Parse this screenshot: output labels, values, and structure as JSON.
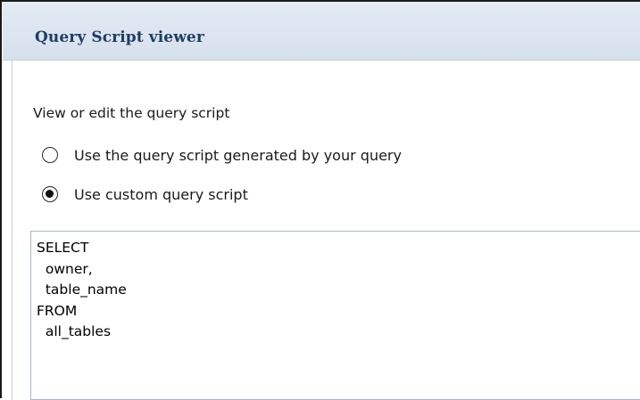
{
  "dialog": {
    "title": "Query Script viewer"
  },
  "main": {
    "instruction": "View or edit the query script",
    "options": [
      {
        "label": "Use the query script generated by your query",
        "selected": false
      },
      {
        "label": "Use custom query script",
        "selected": true
      }
    ],
    "script": {
      "lines": [
        "SELECT",
        "  owner,",
        "  table_name",
        "FROM",
        "  all_tables"
      ]
    }
  },
  "colors": {
    "title_text": "#1f3c66",
    "title_bar": "#dfe7f1",
    "editor_border": "#a9b7c6"
  },
  "icons": {
    "radio_unselected": "radio-unselected-icon",
    "radio_selected": "radio-selected-icon"
  }
}
